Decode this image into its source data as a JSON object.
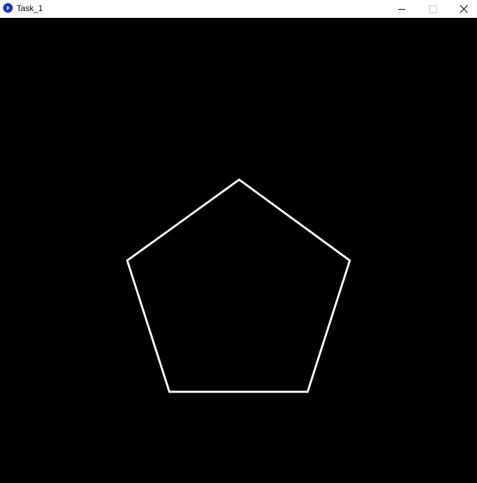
{
  "window": {
    "title": "Task_1",
    "canvas_background": "#000000",
    "shape_stroke_color": "#ffffff",
    "app_icon_color": "#1f3bb3"
  },
  "titlebar": {
    "icons": {
      "app": "processing-app-icon",
      "minimize": "minimize-icon",
      "maximize": "maximize-icon",
      "close": "close-icon"
    }
  },
  "canvas": {
    "shape": "pentagon",
    "sides": 5,
    "fill": "none"
  }
}
